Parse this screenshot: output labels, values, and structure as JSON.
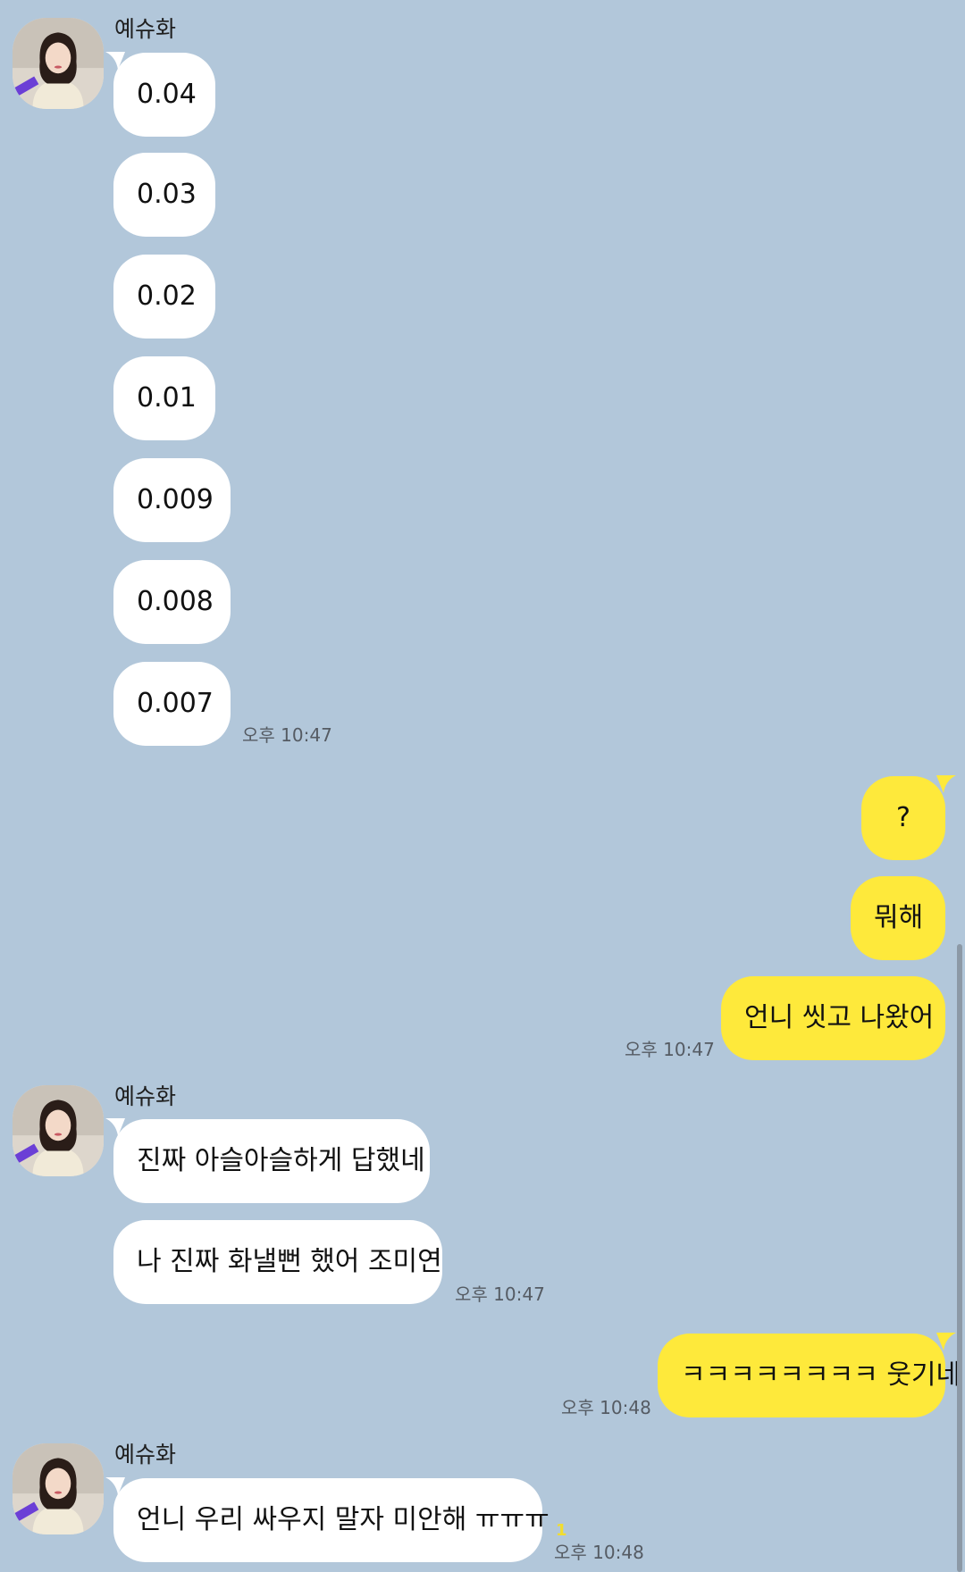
{
  "sender": "예슈화",
  "messages": {
    "m1": "0.04",
    "m2": "0.03",
    "m3": "0.02",
    "m4": "0.01",
    "m5": "0.009",
    "m6": "0.008",
    "m7": "0.007",
    "m8": "?",
    "m9": "뭐해",
    "m10": "언니 씻고 나왔어",
    "m11": "진짜 아슬아슬하게 답했네",
    "m12": "나 진짜 화낼뻔 했어 조미연",
    "m13": "ㅋㅋㅋㅋㅋㅋㅋㅋ 웃기네",
    "m14": "언니 우리 싸우지 말자 미안해 ㅠㅠㅠ"
  },
  "times": {
    "t1": "오후 10:47",
    "t2": "오후 10:47",
    "t3": "오후 10:47",
    "t4": "오후 10:48",
    "t5": "오후 10:48"
  },
  "unread_count": "1",
  "colors": {
    "background": "#b2c7da",
    "incoming_bubble": "#ffffff",
    "outgoing_bubble": "#fee93b",
    "unread": "#f2dd2e"
  },
  "icons": {
    "avatar": "profile-photo"
  }
}
